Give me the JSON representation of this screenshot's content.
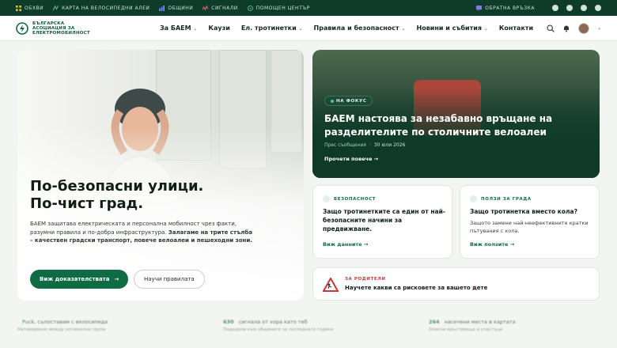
{
  "topbar": {
    "links": [
      {
        "label": "ОБХВИ",
        "icon": "grid-icon"
      },
      {
        "label": "КАРТА НА ВЕЛОСИПЕДНИ АЛЕИ",
        "icon": "map-icon"
      },
      {
        "label": "ОБЩИНИ",
        "icon": "chart-icon"
      },
      {
        "label": "СИГНАЛИ",
        "icon": "signal-icon"
      },
      {
        "label": "ПОМОЩЕН ЦЕНТЪР",
        "icon": "help-icon"
      }
    ],
    "feedback": "ОБРАТНА ВРЪЗКА",
    "social": [
      "facebook-icon",
      "instagram-icon",
      "youtube-icon",
      "linkedin-icon"
    ]
  },
  "header": {
    "logo_lines": [
      "БЪЛГАРСКА",
      "АСОЦИАЦИЯ ЗА",
      "ЕЛЕКТРОМОБИЛНОСТ"
    ],
    "nav": [
      "За БАЕМ",
      "Каузи",
      "Ел. тротинетки",
      "Правила и безопасност",
      "Новини и събития",
      "Контакти"
    ]
  },
  "hero": {
    "title_line1": "По-безопасни улици.",
    "title_line2": "По-чист град.",
    "desc_start": "БАЕМ защитава електрическата и персонална мобилност чрез факти, разумни правила и по-добра инфраструктура.",
    "desc_bold": "Залагаме на трите стълба – качествен градски транспорт, повече велоалеи и пешеходни зони.",
    "primary_btn": "Виж доказателствата",
    "secondary_btn": "Научи правилата"
  },
  "feature": {
    "badge": "НА ФОКУС",
    "title": "БАЕМ настоява за незабавно връщане на разделителите по столичните велоалеи",
    "category": "Прес съобщения",
    "separator": "·",
    "date": "30 юли 2026",
    "link": "Прочети повече"
  },
  "cards": [
    {
      "tag": "БЕЗОПАСНОСТ",
      "title": "Защо тротинетките са един от най-безопасните начини за предвижване.",
      "text": "",
      "link": "Виж данните"
    },
    {
      "tag": "ПОЛЗИ ЗА ГРАДА",
      "title": "Защо тротинетка вместо кола?",
      "text": "Защото замени най-неефективните кратки пътувания с кола.",
      "link": "Виж ползите"
    }
  ],
  "parents": {
    "tag": "ЗА РОДИТЕЛИ",
    "title": "Научете какви са рисковете за вашето дете"
  },
  "stats": [
    {
      "num": "",
      "label": "Puck, съпоставим с велосипеда",
      "sub": "Натоварване между оптимални групи"
    },
    {
      "num": "630",
      "label": "сигнала от хора като теб",
      "sub": "Подадени към общините за последната година"
    },
    {
      "num": "264",
      "label": "насечени места в картата",
      "sub": "Опасни кръстовища и участъци"
    }
  ],
  "colors": {
    "brand": "#0f6b43",
    "dark": "#0e3b2a",
    "alert": "#c23a3a"
  }
}
